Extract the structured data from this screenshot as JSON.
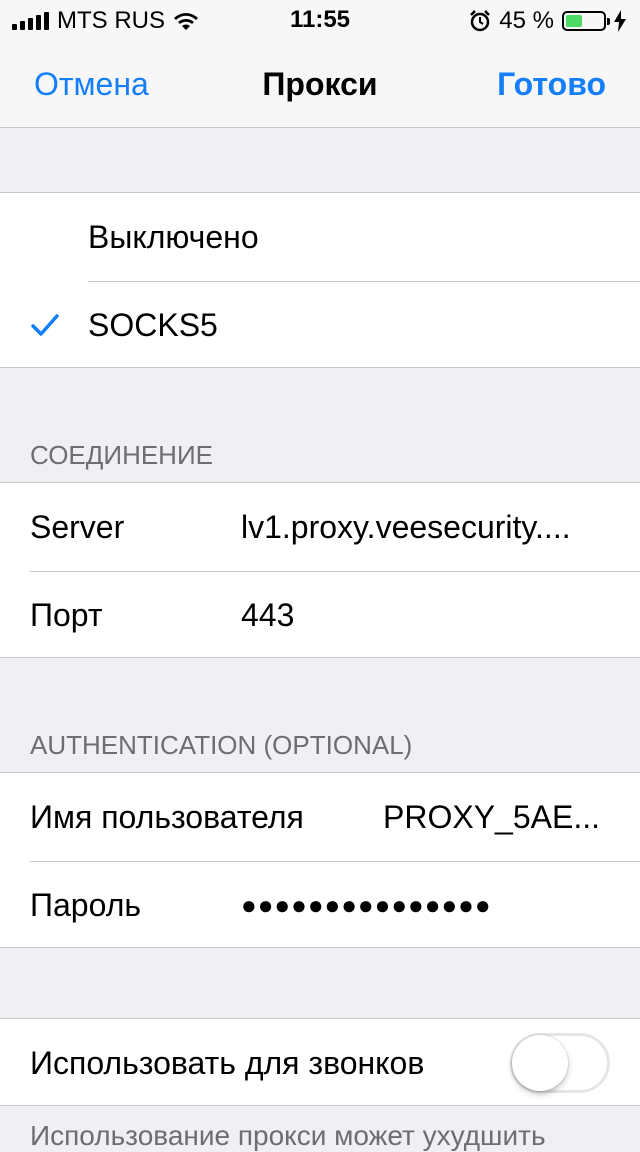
{
  "status_bar": {
    "carrier": "MTS RUS",
    "time": "11:55",
    "battery_percent": "45 %",
    "battery_level": 0.45,
    "battery_color": "#4cd964"
  },
  "nav": {
    "cancel": "Отмена",
    "title": "Прокси",
    "done": "Готово",
    "accent_color": "#157efb"
  },
  "mode_options": [
    {
      "label": "Выключено",
      "selected": false
    },
    {
      "label": "SOCKS5",
      "selected": true
    }
  ],
  "connection": {
    "header": "СОЕДИНЕНИЕ",
    "server_label": "Server",
    "server_value": "lv1.proxy.veesecurity....",
    "port_label": "Порт",
    "port_value": "443"
  },
  "auth": {
    "header": "AUTHENTICATION (OPTIONAL)",
    "username_label": "Имя пользователя",
    "username_value": "PROXY_5AE...",
    "password_label": "Пароль",
    "password_value": "●●●●●●●●●●●●●●●"
  },
  "calls": {
    "label": "Использовать для звонков",
    "enabled": false
  },
  "footer": {
    "text": "Использование прокси может ухудшить"
  },
  "icons": [
    "signal-bars-icon",
    "wifi-icon",
    "alarm-icon",
    "battery-icon",
    "charging-bolt-icon",
    "checkmark-icon"
  ]
}
